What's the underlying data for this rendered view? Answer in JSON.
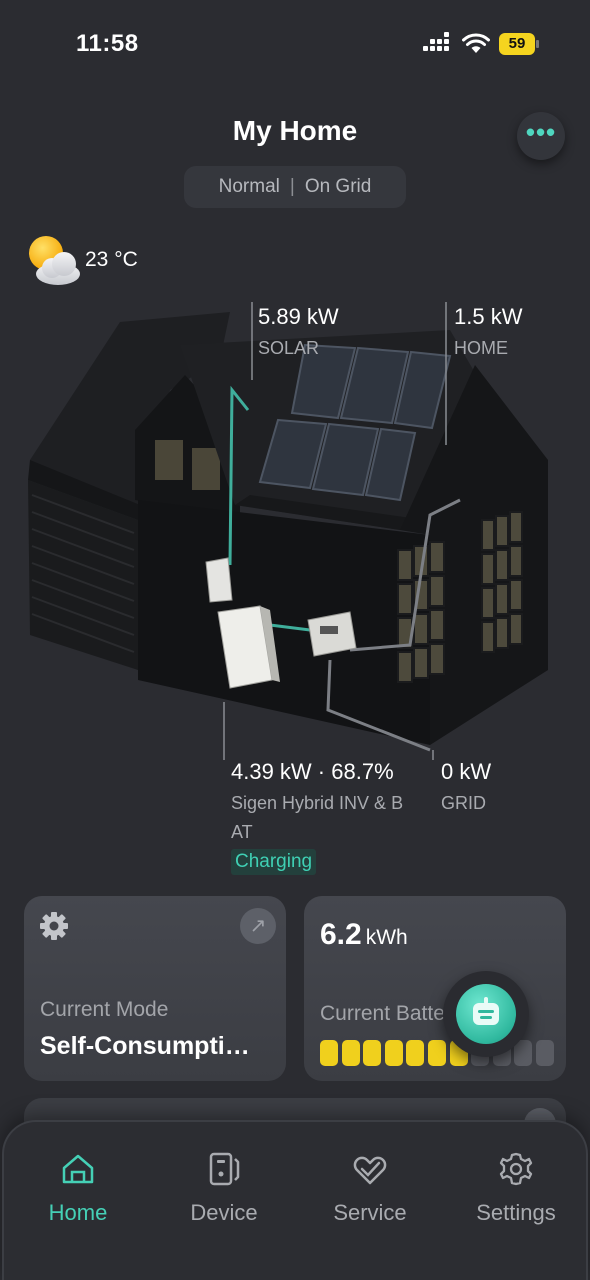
{
  "status_bar": {
    "time": "11:58",
    "battery_level": "59",
    "battery_color": "#f5d41f"
  },
  "header": {
    "title": "My Home",
    "more_icon": "more-dots-icon",
    "status_mode": "Normal",
    "status_separator": "|",
    "status_grid": "On Grid"
  },
  "weather": {
    "icon": "partly-cloudy-icon",
    "temperature": "23 °C"
  },
  "energy_flow": {
    "solar": {
      "value": "5.89 kW",
      "label": "SOLAR"
    },
    "home": {
      "value": "1.5 kW",
      "label": "HOME"
    },
    "inverter": {
      "value": "4.39 kW · 68.7%",
      "label_line1": "Sigen Hybrid INV & B",
      "label_line2": "AT",
      "status": "Charging"
    },
    "grid": {
      "value": "0 kW",
      "label": "GRID"
    }
  },
  "cards": {
    "mode": {
      "icon": "gear-icon",
      "arrow_icon": "arrow-up-right-icon",
      "label": "Current Mode",
      "value": "Self-Consumpti…"
    },
    "battery": {
      "value": "6.2",
      "unit": "kWh",
      "label": "Current Battery Level",
      "level_bars_filled": 7,
      "level_bars_total": 11
    }
  },
  "assistant": {
    "icon": "assistant-robot-icon"
  },
  "colors": {
    "accent": "#45d0b6",
    "background": "#2b2c31",
    "card": "#3f4147",
    "battery_filled": "#f0d01d",
    "battery_empty": "#5a5c63"
  },
  "tabbar": {
    "items": [
      {
        "label": "Home",
        "icon": "home-icon",
        "active": true
      },
      {
        "label": "Device",
        "icon": "device-icon",
        "active": false
      },
      {
        "label": "Service",
        "icon": "service-heart-icon",
        "active": false
      },
      {
        "label": "Settings",
        "icon": "settings-gear-icon",
        "active": false
      }
    ]
  }
}
